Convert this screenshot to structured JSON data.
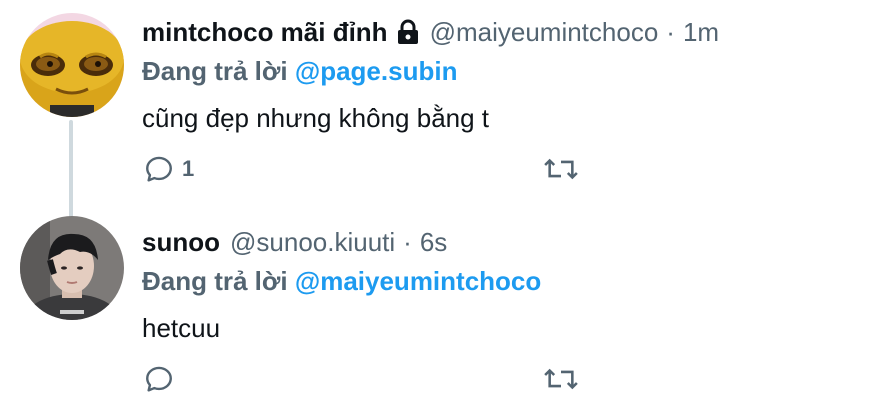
{
  "tweets": [
    {
      "author_name": "mintchoco mãi đỉnh",
      "handle": "@maiyeumintchoco",
      "separator": "·",
      "time": "1m",
      "locked": true,
      "reply_prefix": "Đang trả lời",
      "reply_to": "@page.subin",
      "text": "cũng đẹp nhưng không bằng t",
      "reply_count": "1"
    },
    {
      "author_name": "sunoo",
      "handle": "@sunoo.kiuuti",
      "separator": "·",
      "time": "6s",
      "locked": false,
      "reply_prefix": "Đang trả lời",
      "reply_to": "@maiyeumintchoco",
      "text": "hetcuu",
      "reply_count": ""
    }
  ],
  "colors": {
    "accent": "#1d9bf0",
    "secondary_text": "#536471",
    "primary_text": "#0f1419",
    "thread_line": "#cfd9de"
  }
}
